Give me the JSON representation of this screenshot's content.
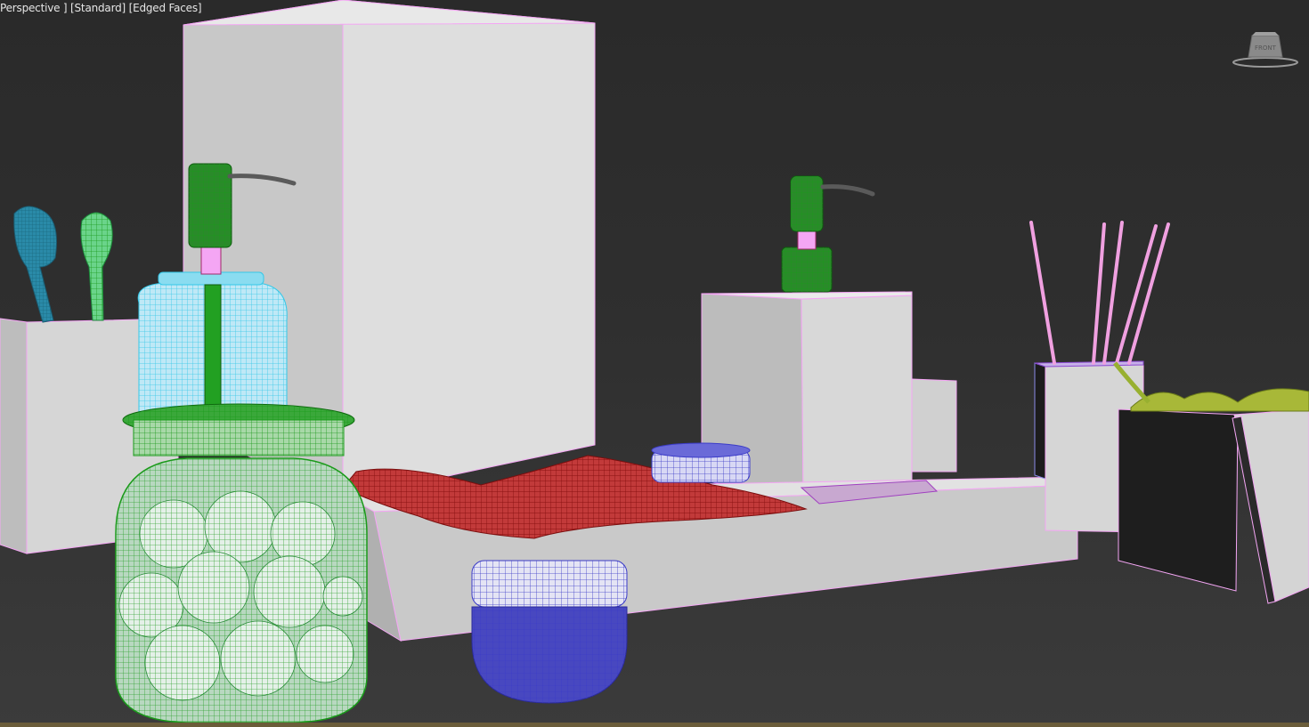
{
  "viewport": {
    "label_parts": [
      "Perspective",
      "Standard",
      "Edged Faces"
    ],
    "viewcube_face": "FRONT"
  },
  "colors": {
    "background": "#2d2d2d",
    "object_white": "#d8d8d8",
    "edge_pink": "#f4a6f4",
    "cyan_wire": "#35c8e8",
    "green_wire": "#18a018",
    "blue_wire": "#3c3cc8",
    "red_wire": "#a01818"
  },
  "scene_objects": [
    "toothbrush-holder",
    "toothbrush-blue",
    "toothbrush-green",
    "soap-dispenser-large",
    "jar-with-balls",
    "tall-box",
    "tray",
    "towel",
    "cream-jar-small",
    "cream-jar-large",
    "soap-dispenser-small",
    "pedestal-block",
    "reed-diffuser",
    "plant-box"
  ]
}
